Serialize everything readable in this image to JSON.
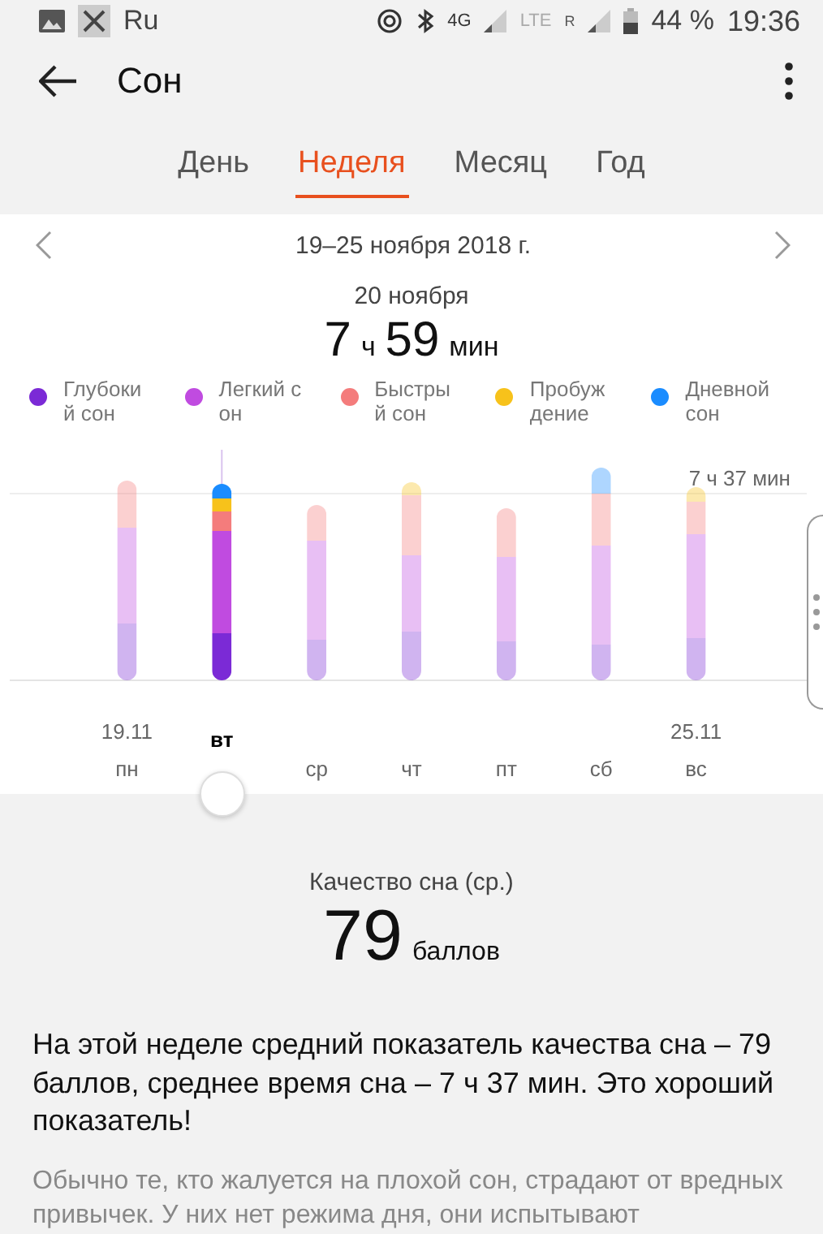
{
  "status_bar": {
    "app_label": "Ru",
    "network_1": "4G",
    "network_2": "LTE",
    "network_2_roaming": "R",
    "battery_text": "44 %",
    "time": "19:36"
  },
  "header": {
    "title": "Сон"
  },
  "tabs": [
    {
      "label": "День",
      "selected": false
    },
    {
      "label": "Неделя",
      "selected": true
    },
    {
      "label": "Месяц",
      "selected": false
    },
    {
      "label": "Год",
      "selected": false
    }
  ],
  "period": {
    "range": "19–25 ноября 2018 г.",
    "day": "20 ноября",
    "hours": "7",
    "hours_unit": "ч",
    "minutes": "59",
    "minutes_unit": "мин"
  },
  "legend": [
    {
      "label": "Глубокий сон",
      "color": "#7b2ad6"
    },
    {
      "label": "Легкий сон",
      "color": "#c04be0"
    },
    {
      "label": "Быстрый сон",
      "color": "#f47c7c"
    },
    {
      "label": "Пробуждение",
      "color": "#f7c21b"
    },
    {
      "label": "Дневной сон",
      "color": "#1a8cff"
    }
  ],
  "chart": {
    "average_label": "7 ч 37 мин"
  },
  "days": [
    {
      "label": "пн",
      "date": "19.11",
      "selected": false
    },
    {
      "label": "вт",
      "selected": true
    },
    {
      "label": "ср",
      "selected": false
    },
    {
      "label": "чт",
      "selected": false
    },
    {
      "label": "пт",
      "selected": false
    },
    {
      "label": "сб",
      "selected": false
    },
    {
      "label": "вс",
      "date": "25.11",
      "selected": false
    }
  ],
  "quality": {
    "label": "Качество сна (ср.)",
    "score": "79",
    "unit": "баллов"
  },
  "summary": "На этой неделе средний показатель качества сна – 79 баллов, среднее время сна – 7 ч 37 мин. Это хороший показатель!",
  "advice": "Обычно те, кто жалуется на плохой сон, страдают от вредных привычек. У них нет режима дня, они испытывают"
}
